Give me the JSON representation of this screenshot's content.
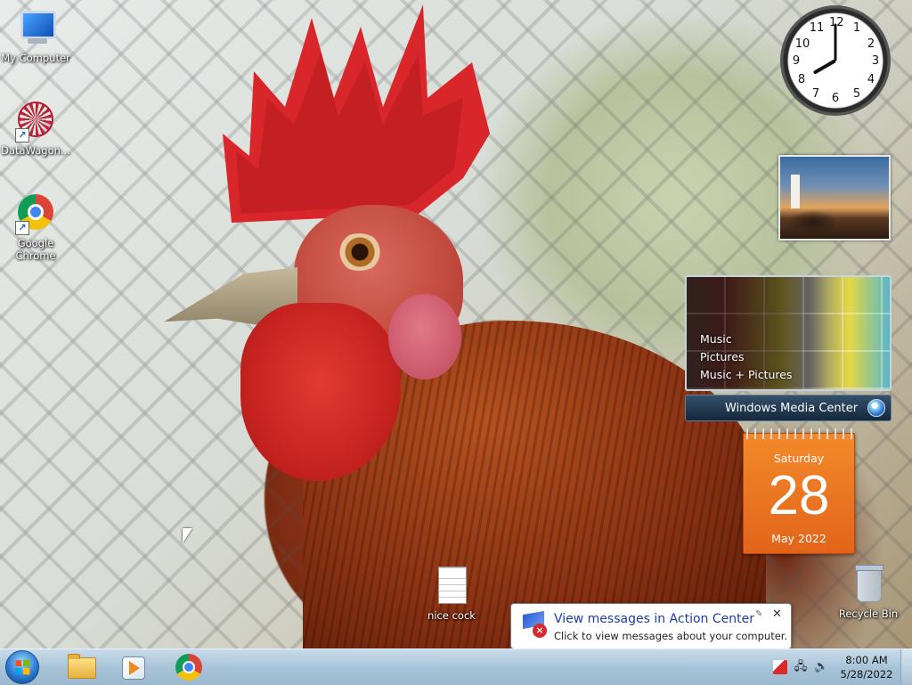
{
  "desktop": {
    "icons": [
      {
        "label": "My Computer",
        "icon": "computer-icon"
      },
      {
        "label": "DataWagon...",
        "icon": "datawagon-icon"
      },
      {
        "label": "Google Chrome",
        "icon": "chrome-icon"
      },
      {
        "label": "nice cock",
        "icon": "text-document-icon"
      },
      {
        "label": "Recycle Bin",
        "icon": "recycle-bin-icon"
      }
    ]
  },
  "gadgets": {
    "clock": {
      "numbers": [
        "12",
        "1",
        "2",
        "3",
        "4",
        "5",
        "6",
        "7",
        "8",
        "9",
        "10",
        "11"
      ],
      "hour": 8,
      "minute": 0
    },
    "media_center": {
      "items": [
        "Music",
        "Pictures",
        "Music + Pictures"
      ],
      "brand_bold": "Windows",
      "brand_rest": " Media Center"
    },
    "calendar": {
      "day": "Saturday",
      "date": "28",
      "month_year": "May 2022"
    }
  },
  "notification": {
    "title": "View messages in Action Center",
    "text": "Click to view messages about your computer.",
    "close": "✕",
    "pin": "✎"
  },
  "taskbar": {
    "pinned": [
      "windows-explorer-icon",
      "media-player-icon",
      "chrome-icon"
    ],
    "tray": {
      "time": "8:00 AM",
      "date": "5/28/2022"
    }
  },
  "colors": {
    "taskbar": "#a9c4d8",
    "calendar": "#e2641a",
    "balloon_title": "#1e3da8"
  }
}
